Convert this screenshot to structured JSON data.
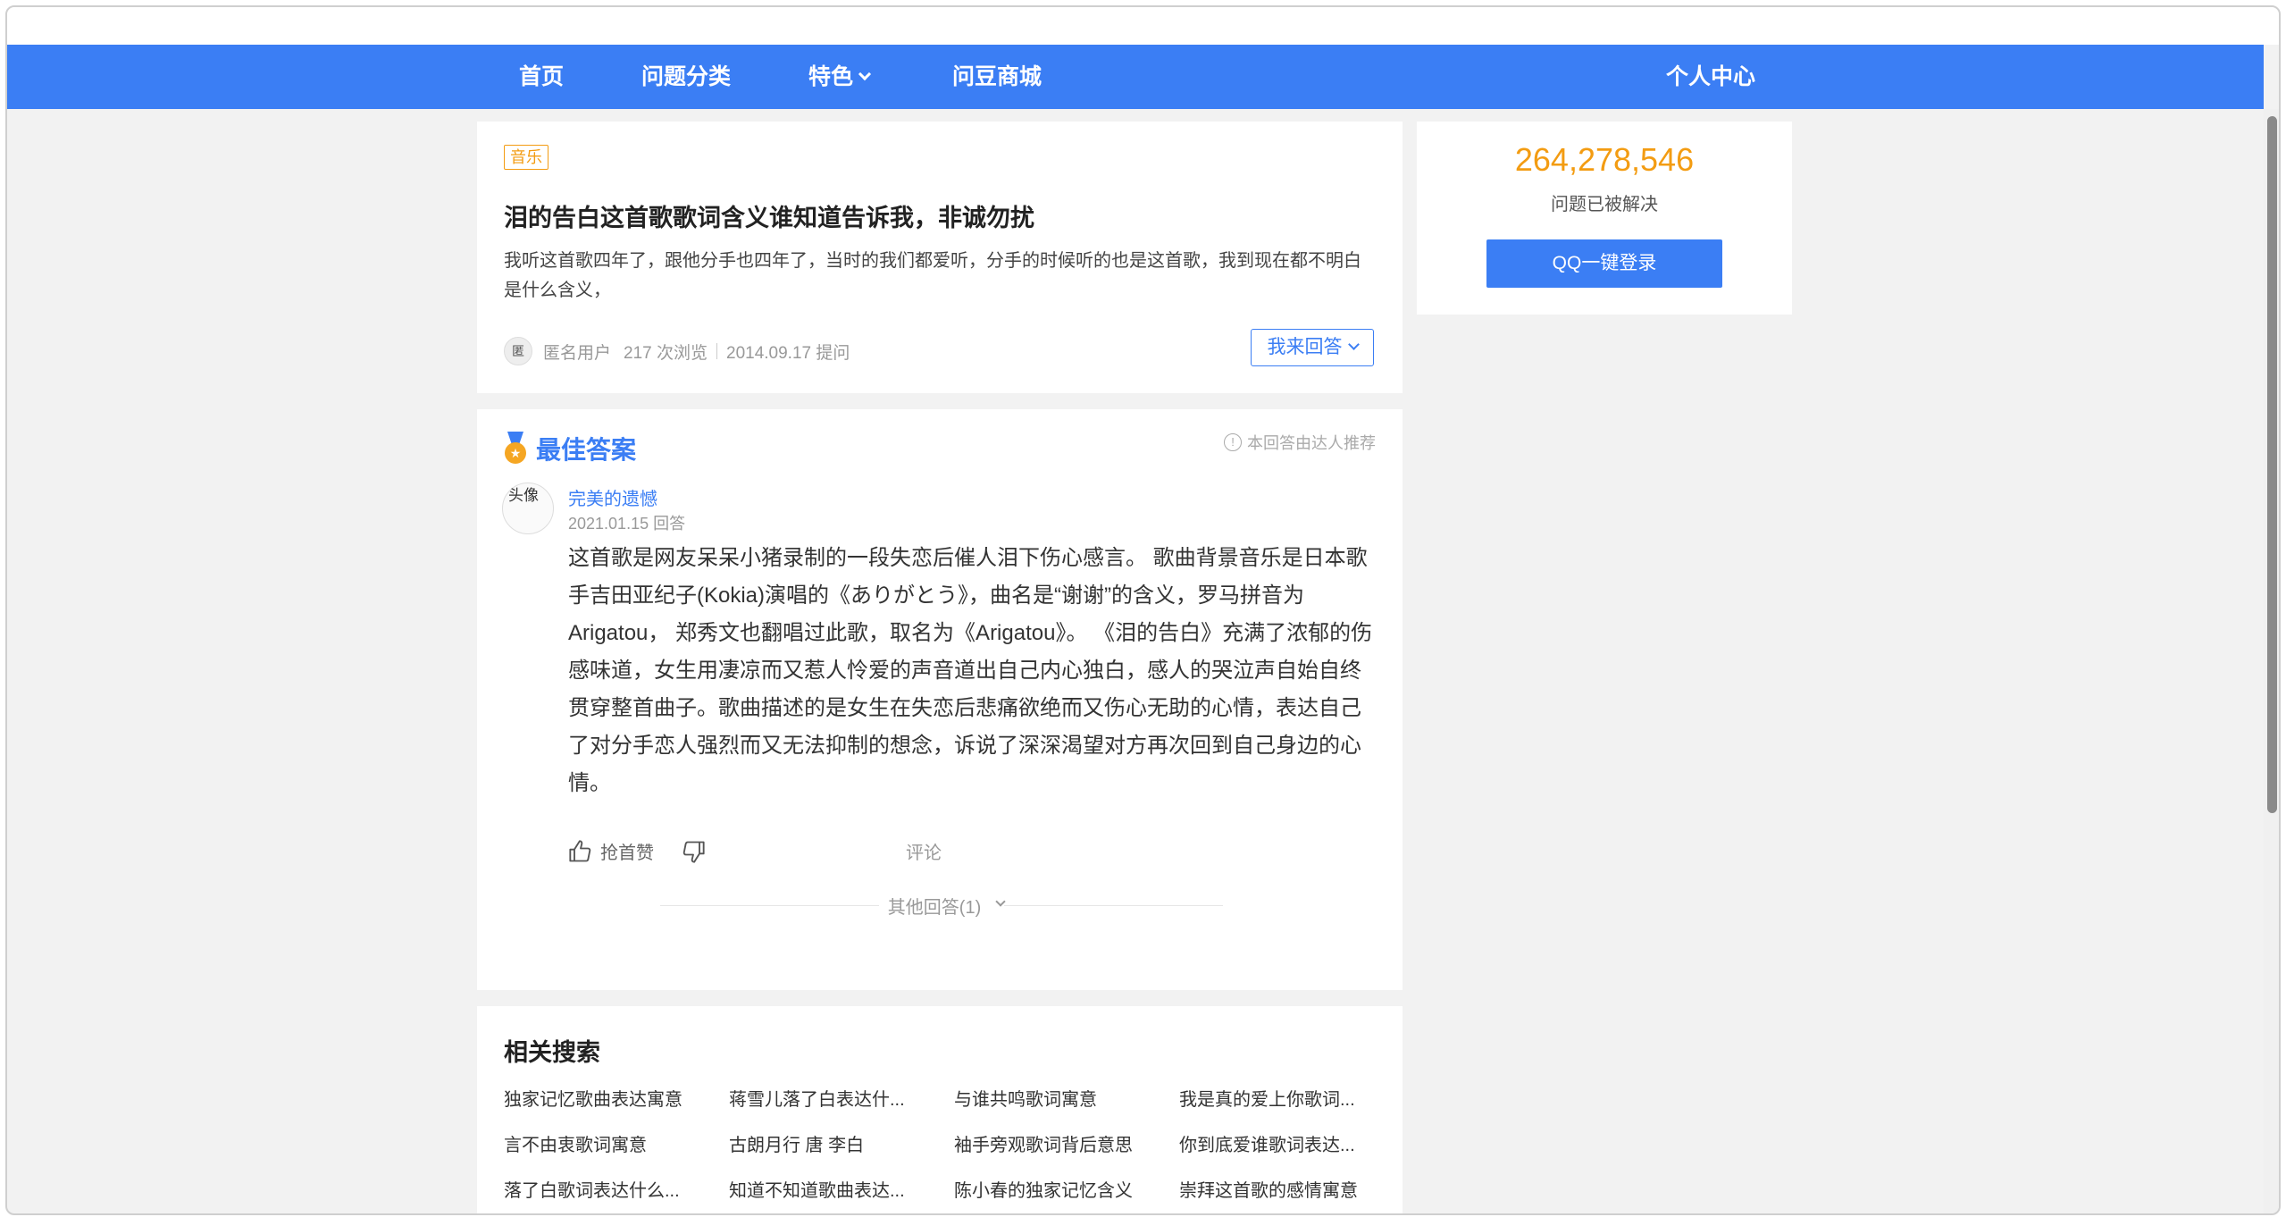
{
  "nav": {
    "home": "首页",
    "categories": "问题分类",
    "featured": "特色",
    "mall": "问豆商城",
    "profile": "个人中心"
  },
  "question": {
    "tag": "音乐",
    "title": "泪的告白这首歌歌词含义谁知道告诉我，非诚勿扰",
    "description": "我听这首歌四年了，跟他分手也四年了，当时的我们都爱听，分手的时候听的也是这首歌，我到现在都不明白是什么含义，",
    "author": "匿名用户",
    "views": "217 次浏览",
    "date": "2014.09.17 提问",
    "answer_button": "我来回答"
  },
  "best_answer": {
    "heading": "最佳答案",
    "recommend": "本回答由达人推荐",
    "avatar_alt": "头像",
    "user": "完美的遗憾",
    "date": "2021.01.15 回答",
    "body": "这首歌是网友呆呆小猪录制的一段失恋后催人泪下伤心感言。 歌曲背景音乐是日本歌手吉田亚纪子(Kokia)演唱的《ありがとう》，曲名是“谢谢”的含义，罗马拼音为Arigatou， 郑秀文也翻唱过此歌，取名为《Arigatou》。 《泪的告白》充满了浓郁的伤感味道，女生用凄凉而又惹人怜爱的声音道出自己内心独白，感人的哭泣声自始自终贯穿整首曲子。歌曲描述的是女生在失恋后悲痛欲绝而又伤心无助的心情，表达自己了对分手恋人强烈而又无法抑制的想念，诉说了深深渴望对方再次回到自己身边的心情。",
    "like": "抢首赞",
    "comment": "评论",
    "other_answers": "其他回答(1)"
  },
  "related": {
    "title": "相关搜索",
    "items": [
      "独家记忆歌曲表达寓意",
      "蒋雪儿落了白表达什...",
      "与谁共鸣歌词寓意",
      "我是真的爱上你歌词...",
      "言不由衷歌词寓意",
      "古朗月行 唐 李白",
      "袖手旁观歌词背后意思",
      "你到底爱谁歌词表达...",
      "落了白歌词表达什么...",
      "知道不知道歌曲表达...",
      "陈小春的独家记忆含义",
      "崇拜这首歌的感情寓意"
    ]
  },
  "sidebar": {
    "count": "264,278,546",
    "count_label": "问题已被解决",
    "qq_login": "QQ一键登录"
  },
  "colors": {
    "brand": "#3b7ef4",
    "accent": "#f39c12"
  }
}
